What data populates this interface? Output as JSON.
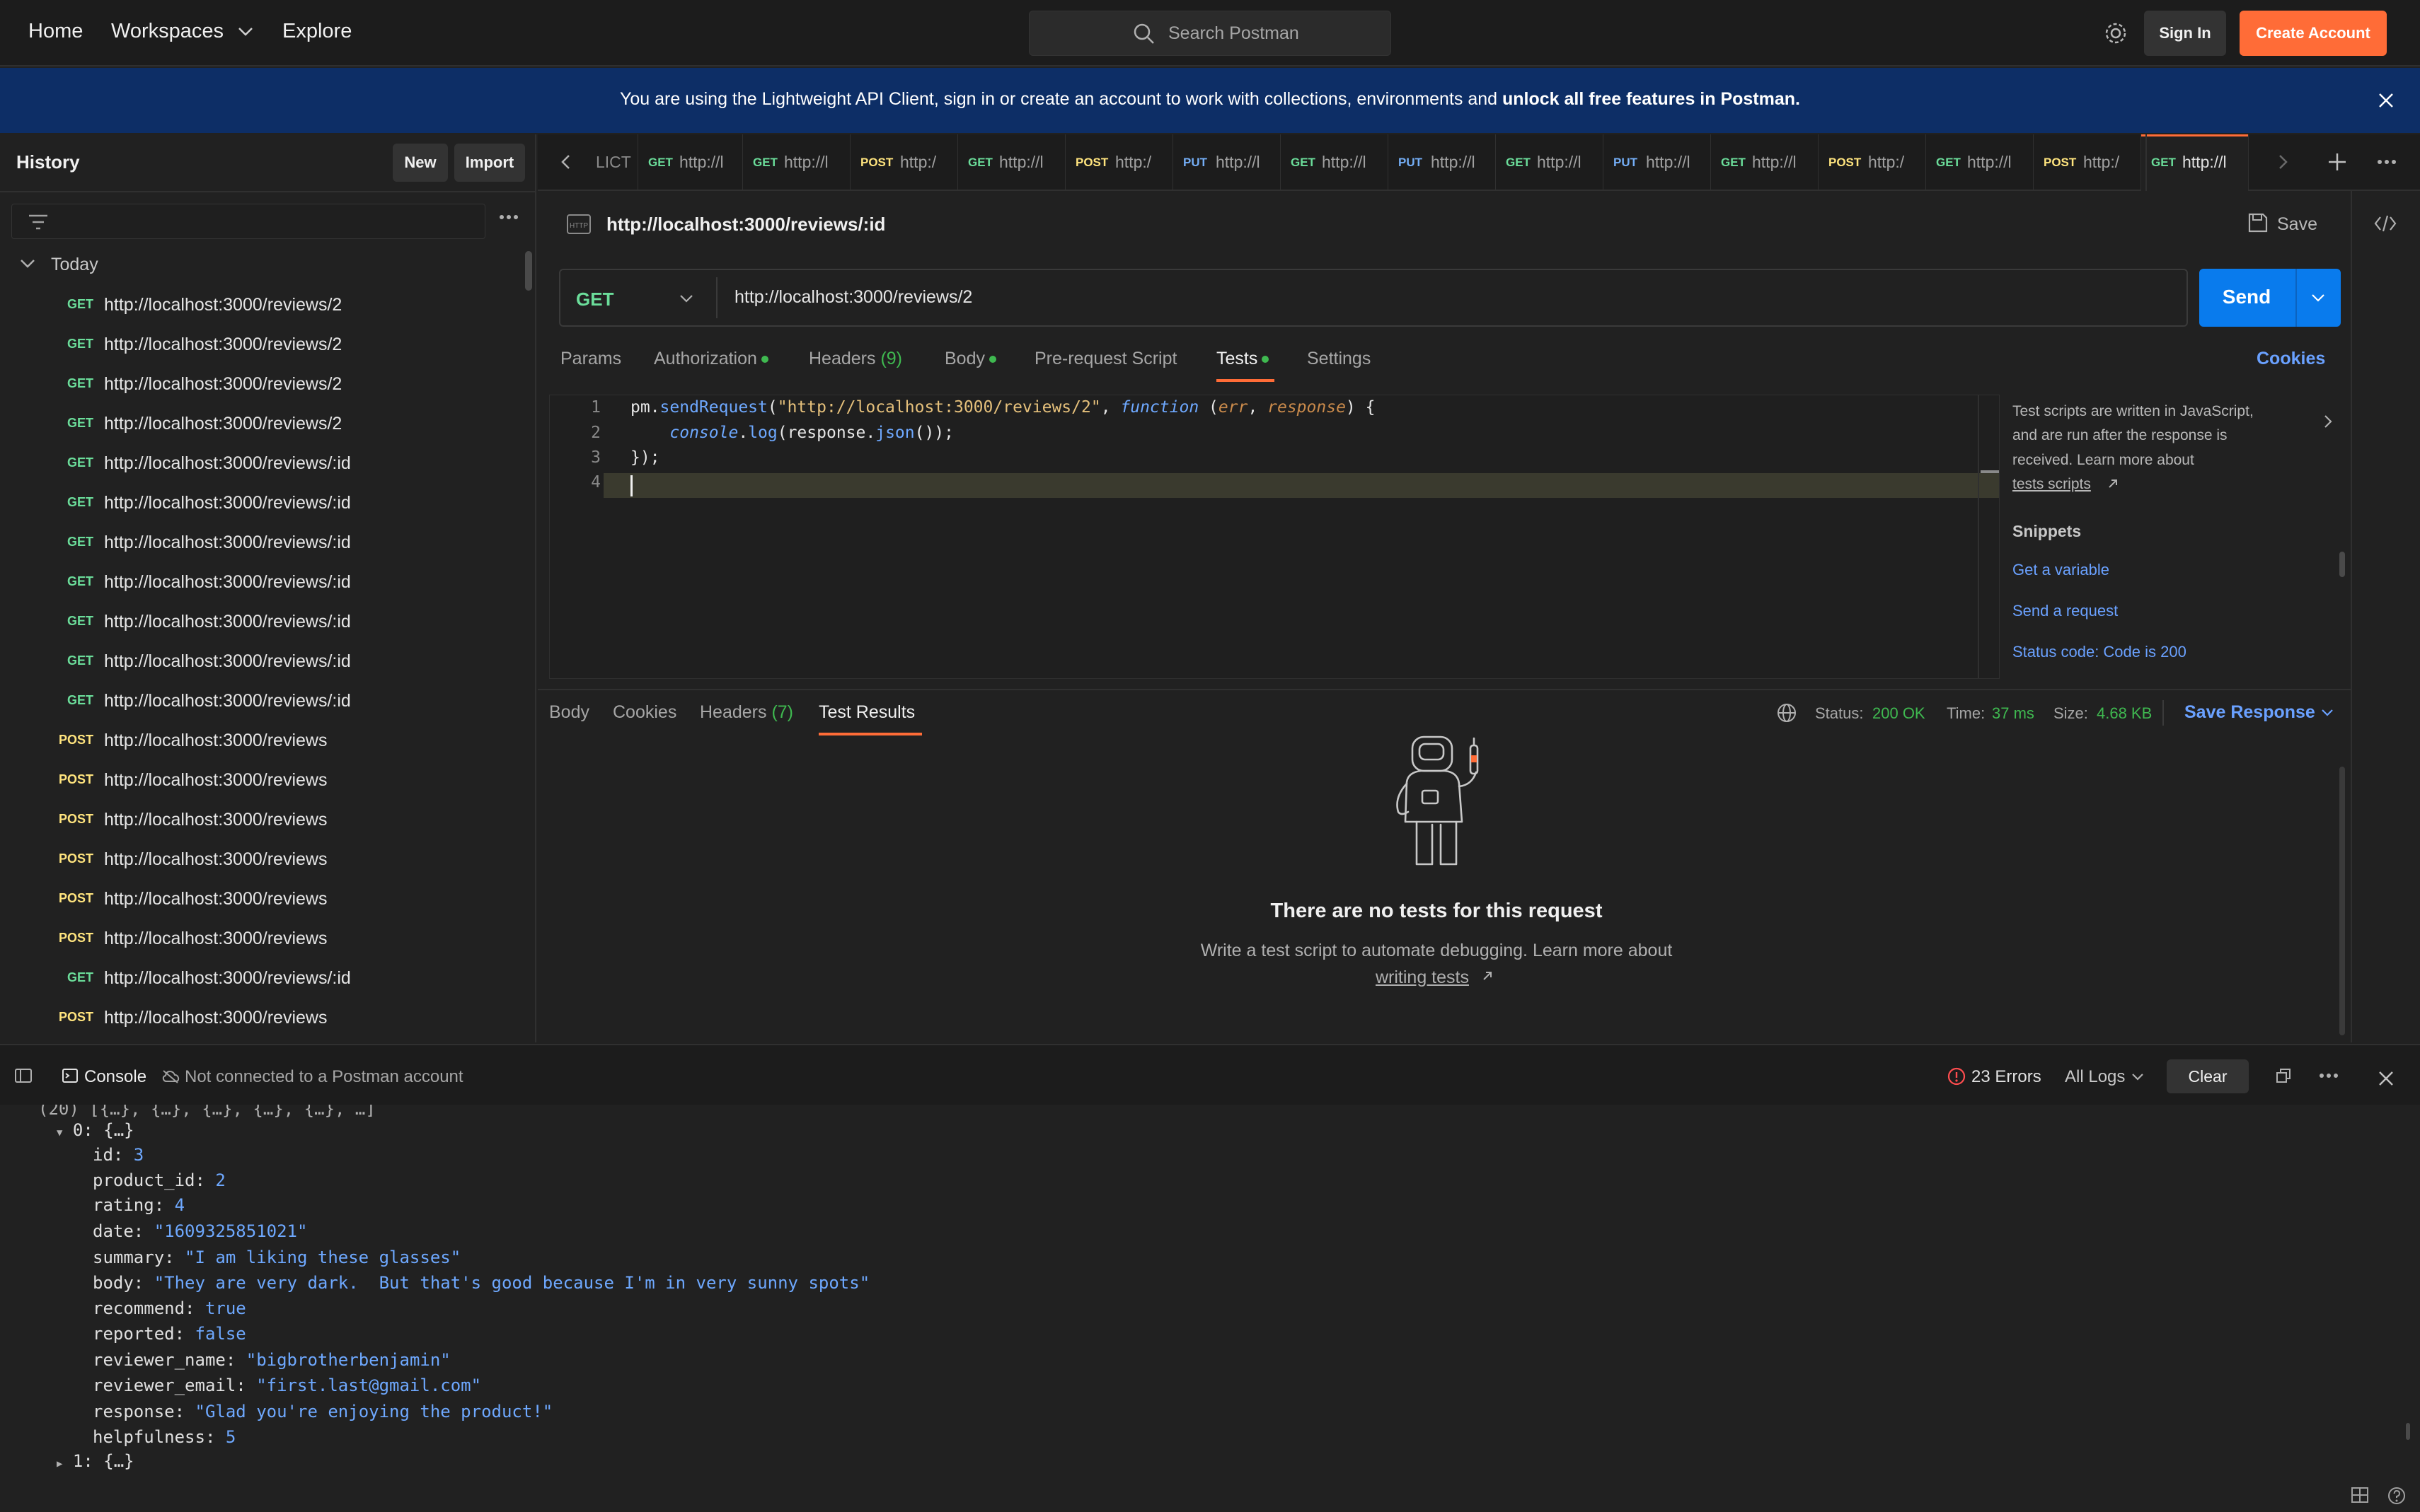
{
  "topbar": {
    "home": "Home",
    "workspaces": "Workspaces",
    "explore": "Explore",
    "search_placeholder": "Search Postman",
    "sign_in": "Sign In",
    "create_account": "Create Account"
  },
  "banner": {
    "text": "You are using the Lightweight API Client, sign in or create an account to work with collections, environments and ",
    "bold": "unlock all free features in Postman."
  },
  "sidebar": {
    "title": "History",
    "new_label": "New",
    "import_label": "Import",
    "group_label": "Today",
    "items": [
      {
        "method": "GET",
        "url": "http://localhost:3000/reviews/2"
      },
      {
        "method": "GET",
        "url": "http://localhost:3000/reviews/2"
      },
      {
        "method": "GET",
        "url": "http://localhost:3000/reviews/2"
      },
      {
        "method": "GET",
        "url": "http://localhost:3000/reviews/2"
      },
      {
        "method": "GET",
        "url": "http://localhost:3000/reviews/:id"
      },
      {
        "method": "GET",
        "url": "http://localhost:3000/reviews/:id"
      },
      {
        "method": "GET",
        "url": "http://localhost:3000/reviews/:id"
      },
      {
        "method": "GET",
        "url": "http://localhost:3000/reviews/:id"
      },
      {
        "method": "GET",
        "url": "http://localhost:3000/reviews/:id"
      },
      {
        "method": "GET",
        "url": "http://localhost:3000/reviews/:id"
      },
      {
        "method": "GET",
        "url": "http://localhost:3000/reviews/:id"
      },
      {
        "method": "POST",
        "url": "http://localhost:3000/reviews"
      },
      {
        "method": "POST",
        "url": "http://localhost:3000/reviews"
      },
      {
        "method": "POST",
        "url": "http://localhost:3000/reviews"
      },
      {
        "method": "POST",
        "url": "http://localhost:3000/reviews"
      },
      {
        "method": "POST",
        "url": "http://localhost:3000/reviews"
      },
      {
        "method": "POST",
        "url": "http://localhost:3000/reviews"
      },
      {
        "method": "GET",
        "url": "http://localhost:3000/reviews/:id"
      },
      {
        "method": "POST",
        "url": "http://localhost:3000/reviews"
      }
    ]
  },
  "tabs": {
    "first_partial": "LICT",
    "items": [
      {
        "method": "GET",
        "url": "http://l"
      },
      {
        "method": "GET",
        "url": "http://l"
      },
      {
        "method": "POST",
        "url": "http:/"
      },
      {
        "method": "GET",
        "url": "http://l"
      },
      {
        "method": "POST",
        "url": "http:/"
      },
      {
        "method": "PUT",
        "url": "http://l"
      },
      {
        "method": "GET",
        "url": "http://l"
      },
      {
        "method": "PUT",
        "url": "http://l"
      },
      {
        "method": "GET",
        "url": "http://l"
      },
      {
        "method": "PUT",
        "url": "http://l"
      },
      {
        "method": "GET",
        "url": "http://l"
      },
      {
        "method": "POST",
        "url": "http:/"
      },
      {
        "method": "GET",
        "url": "http://l"
      },
      {
        "method": "POST",
        "url": "http:/"
      },
      {
        "method": "GET",
        "url": "http://l"
      }
    ]
  },
  "request": {
    "title": "http://localhost:3000/reviews/:id",
    "save_label": "Save",
    "method": "GET",
    "url": "http://localhost:3000/reviews/2",
    "send_label": "Send",
    "tabs": {
      "params": "Params",
      "authorization": "Authorization",
      "headers": "Headers",
      "headers_count": "(9)",
      "body": "Body",
      "prerequest": "Pre-request Script",
      "tests": "Tests",
      "settings": "Settings",
      "cookies": "Cookies"
    },
    "code_lines": [
      "1",
      "2",
      "3",
      "4"
    ]
  },
  "help": {
    "line1": "Test scripts are written in JavaScript,",
    "line2": "and are run after the response is",
    "line3": "received. Learn more about",
    "link": "tests scripts",
    "snippets_title": "Snippets",
    "snippet1": "Get a variable",
    "snippet2": "Send a request",
    "snippet3": "Status code: Code is 200"
  },
  "response": {
    "tabs": {
      "body": "Body",
      "cookies": "Cookies",
      "headers": "Headers",
      "headers_count": "(7)",
      "test_results": "Test Results"
    },
    "status_label": "Status:",
    "status_value": "200 OK",
    "time_label": "Time:",
    "time_value": "37 ms",
    "size_label": "Size:",
    "size_value": "4.68 KB",
    "save_response": "Save Response",
    "empty_title": "There are no tests for this request",
    "empty_desc": "Write a test script to automate debugging. Learn more about",
    "empty_link": "writing tests"
  },
  "console": {
    "tab": "Console",
    "account": "Not connected to a Postman account",
    "errors": "23 Errors",
    "filter": "All Logs",
    "clear": "Clear",
    "top_partial": "(20) [{…}, {…}, {…}, {…}, {…}, …]",
    "item0": "0: {…}",
    "item1": "1: {…}",
    "fields": {
      "id": "3",
      "product_id": "2",
      "rating": "4",
      "date": "\"1609325851021\"",
      "summary": "\"I am liking these glasses\"",
      "body": "\"They are very dark.  But that's good because I'm in very sunny spots\"",
      "recommend": "true",
      "reported": "false",
      "reviewer_name": "\"bigbrotherbenjamin\"",
      "reviewer_email": "\"first.last@gmail.com\"",
      "response": "\"Glad you're enjoying the product!\"",
      "helpfulness": "5"
    }
  },
  "colors": {
    "get": "#6bdd9a",
    "post": "#ffe47e",
    "put": "#74aef6",
    "accent": "#ff6c37",
    "link": "#6aa1ff",
    "success": "#3fb950"
  }
}
